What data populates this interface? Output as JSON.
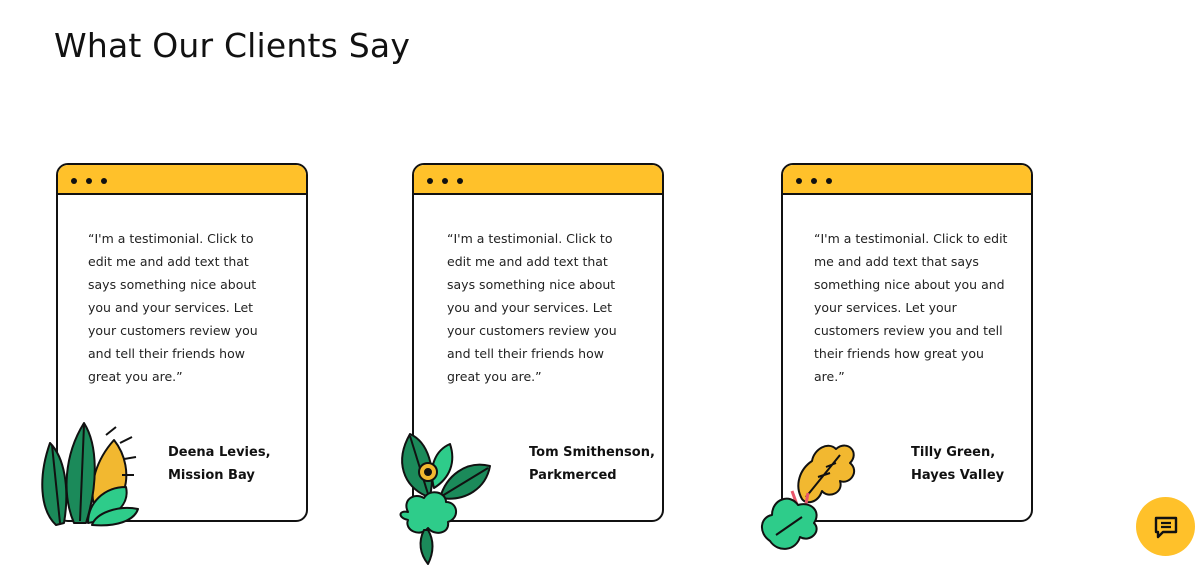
{
  "section": {
    "title": "What Our Clients Say"
  },
  "testimonials": [
    {
      "quote": "“I'm a testimonial. Click to edit me and add text that says something nice about you and your services. Let your customers review you and tell their friends how great you are.”",
      "author": "Deena Levies,\nMission Bay"
    },
    {
      "quote": "“I'm a testimonial. Click to edit me and add text that says something nice about you and your services. Let your customers review you and tell their friends how great you are.”",
      "author": "Tom Smithenson,\nParkmerced"
    },
    {
      "quote": "“I'm a testimonial. Click to edit me and add text that says something nice about you and your services. Let your customers review you and tell their friends how great you are.”",
      "author": "Tilly Green,\nHayes Valley"
    }
  ],
  "colors": {
    "accent": "#FFC12A",
    "leaf_dark": "#1B8A5A",
    "leaf_light": "#2ECC8A",
    "flower": "#F2B830",
    "bud": "#E8556B"
  },
  "chat_button": {
    "icon": "chat-icon"
  }
}
